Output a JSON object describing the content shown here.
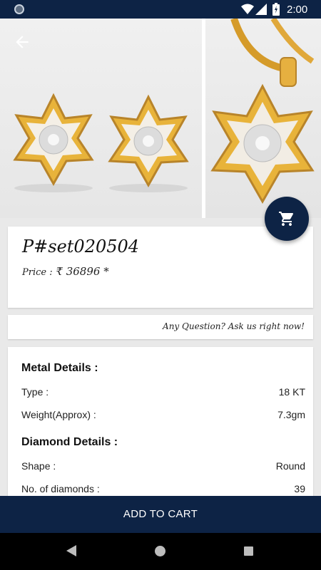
{
  "status_bar": {
    "time": "2:00"
  },
  "product": {
    "code": "P#set020504",
    "price_label": "Price :",
    "price_value": "₹ 36896 *"
  },
  "question_link": "Any Question? Ask us right now!",
  "metal": {
    "title": "Metal Details :",
    "rows": [
      {
        "label": "Type :",
        "value": "18 KT"
      },
      {
        "label": "Weight(Approx) :",
        "value": "7.3gm"
      }
    ]
  },
  "diamond": {
    "title": "Diamond Details :",
    "rows": [
      {
        "label": "Shape :",
        "value": "Round"
      },
      {
        "label": "No. of diamonds :",
        "value": "39"
      }
    ]
  },
  "add_to_cart_label": "ADD TO CART",
  "colors": {
    "primary": "#0d2345",
    "gold": "#e7b53a"
  },
  "icons": [
    "circle-icon",
    "wifi-icon",
    "signal-icon",
    "battery-icon",
    "back-arrow-icon",
    "cart-icon",
    "nav-back-icon",
    "nav-home-icon",
    "nav-recent-icon"
  ]
}
